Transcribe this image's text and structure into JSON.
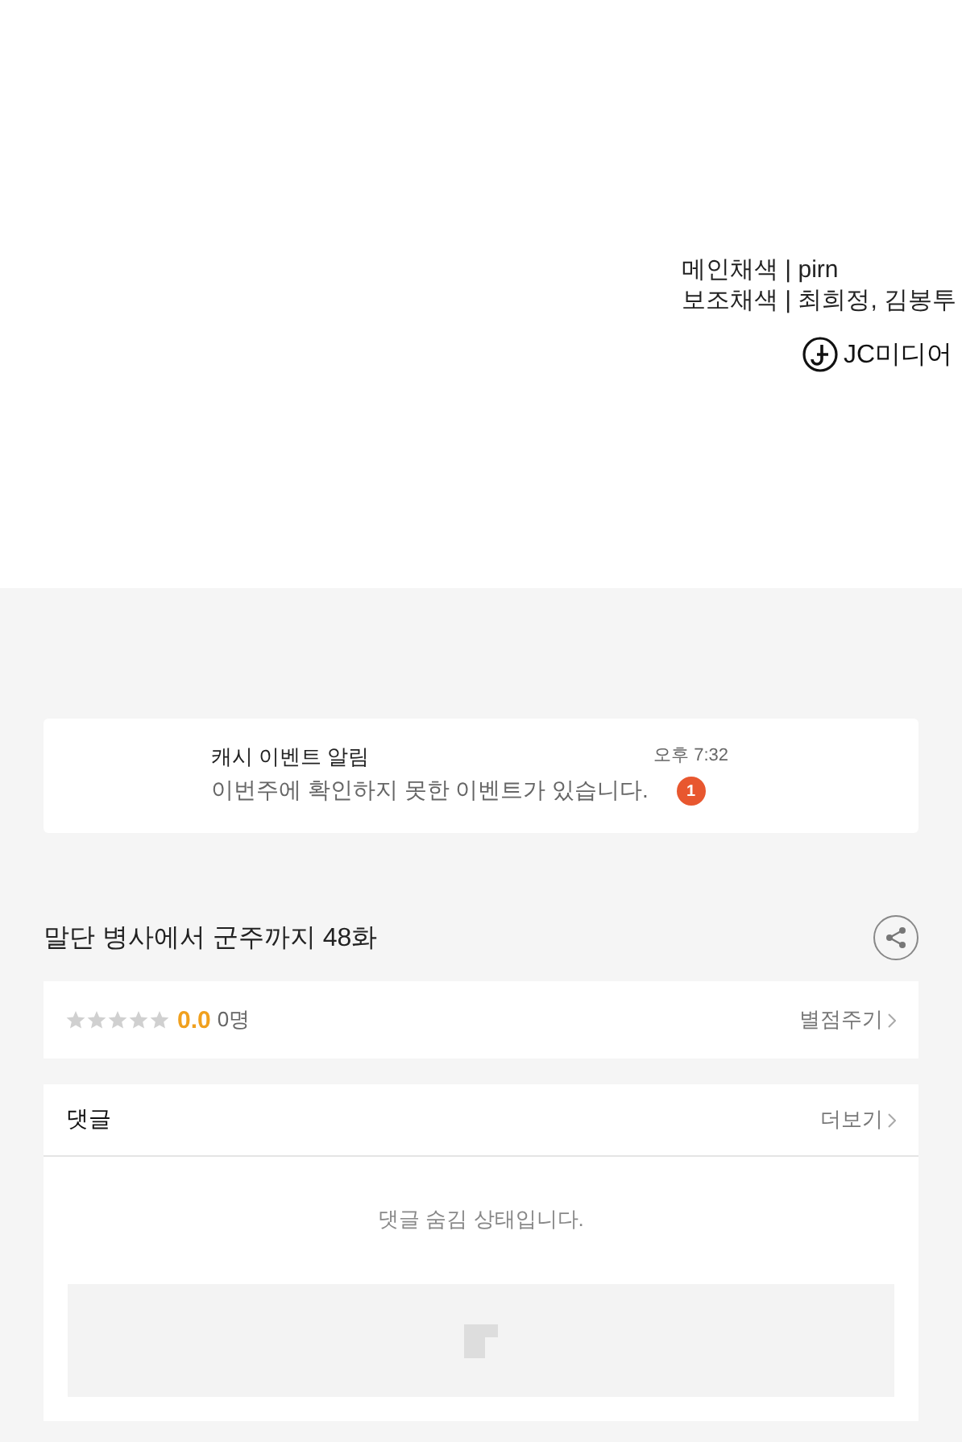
{
  "credits": {
    "lines": [
      "메인채색 | pirn",
      "보조채색 | 최희정, 김봉투"
    ],
    "publisher": "JC미디어"
  },
  "notification": {
    "title": "캐시 이벤트 알림",
    "message": "이번주에 확인하지 못한 이벤트가 있습니다.",
    "time": "오후 7:32",
    "badge": "1"
  },
  "episode": {
    "title": "말단 병사에서 군주까지 48화"
  },
  "rating": {
    "stars": 0,
    "score": "0.0",
    "count": "0명",
    "action": "별점주기"
  },
  "comments": {
    "title": "댓글",
    "more": "더보기",
    "message": "댓글 숨김 상태입니다."
  }
}
